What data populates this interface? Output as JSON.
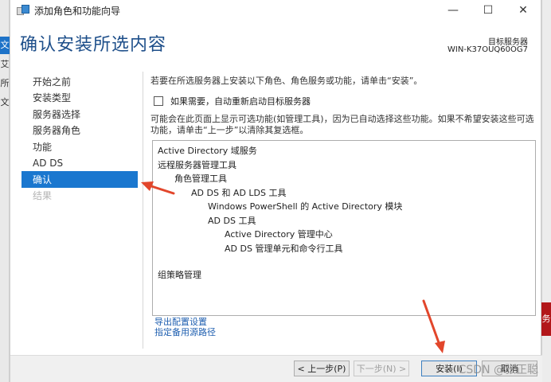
{
  "background": {
    "left_chars": [
      "文",
      "艾",
      "所",
      "文"
    ],
    "right_red_char": "务"
  },
  "window": {
    "title": "添加角色和功能向导",
    "controls": {
      "minimize": "—",
      "maximize": "☐",
      "close": "✕"
    }
  },
  "header": {
    "title": "确认安装所选内容",
    "target_label": "目标服务器",
    "target_server": "WIN-K37OUQ60OG7"
  },
  "nav": {
    "items": [
      {
        "label": "开始之前",
        "state": "normal"
      },
      {
        "label": "安装类型",
        "state": "normal"
      },
      {
        "label": "服务器选择",
        "state": "normal"
      },
      {
        "label": "服务器角色",
        "state": "normal"
      },
      {
        "label": "功能",
        "state": "normal"
      },
      {
        "label": "AD DS",
        "state": "normal"
      },
      {
        "label": "确认",
        "state": "active"
      },
      {
        "label": "结果",
        "state": "disabled"
      }
    ]
  },
  "content": {
    "intro": "若要在所选服务器上安装以下角色、角色服务或功能，请单击“安装”。",
    "restart_label": "如果需要，自动重新启动目标服务器",
    "restart_checked": false,
    "note": "可能会在此页面上显示可选功能(如管理工具)，因为已自动选择这些功能。如果不希望安装这些可选功能，请单击“上一步”以清除其复选框。",
    "selections": [
      {
        "text": "Active Directory 域服务",
        "level": 0
      },
      {
        "text": "远程服务器管理工具",
        "level": 0
      },
      {
        "text": "角色管理工具",
        "level": 1
      },
      {
        "text": "AD DS 和 AD LDS 工具",
        "level": 2
      },
      {
        "text": "Windows PowerShell 的 Active Directory 模块",
        "level": 3
      },
      {
        "text": "AD DS 工具",
        "level": 3
      },
      {
        "text": "Active Directory 管理中心",
        "level": 4
      },
      {
        "text": "AD DS 管理单元和命令行工具",
        "level": 4
      },
      {
        "text": "组策略管理",
        "level": 0
      }
    ],
    "export_link": "导出配置设置",
    "alt_source_link": "指定备用源路径"
  },
  "footer": {
    "prev": "< 上一步(P)",
    "next": "下一步(N) >",
    "install": "安装(I)",
    "cancel": "取消"
  },
  "watermark": "CSDN @张正聪",
  "colors": {
    "title_blue": "#1e4f8a",
    "nav_active": "#1a77cf",
    "link_blue": "#1f5fb0",
    "annotation_red": "#e2462b"
  }
}
